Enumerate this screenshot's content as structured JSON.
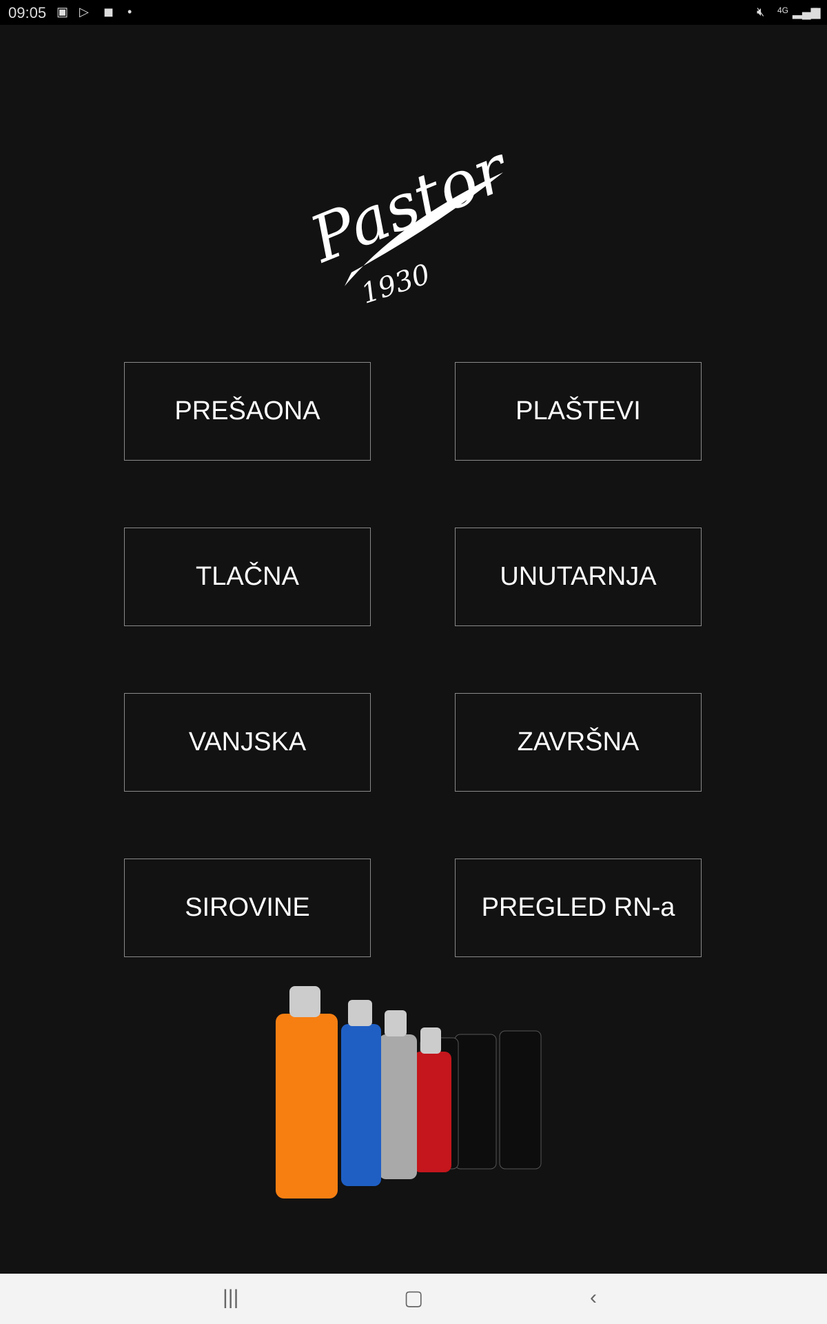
{
  "status_bar": {
    "time": "09:05",
    "network": "4G"
  },
  "logo": {
    "brand": "Pastor",
    "year": "1930"
  },
  "menu": {
    "buttons": [
      {
        "label": "PREŠAONA"
      },
      {
        "label": "PLAŠTEVI"
      },
      {
        "label": "TLAČNA"
      },
      {
        "label": "UNUTARNJA"
      },
      {
        "label": "VANJSKA"
      },
      {
        "label": "ZAVRŠNA"
      },
      {
        "label": "SIROVINE"
      },
      {
        "label": "PREGLED RN-a"
      }
    ]
  },
  "colors": {
    "background": "#121212",
    "border": "#8a8a8a",
    "text": "#ffffff"
  }
}
